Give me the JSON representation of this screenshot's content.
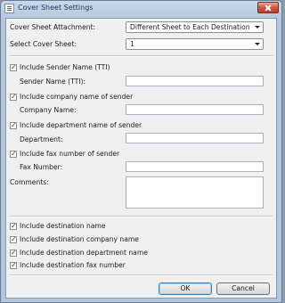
{
  "window": {
    "title": "Cover Sheet Settings"
  },
  "attachment": {
    "label": "Cover Sheet Attachment:",
    "value": "Different Sheet to Each Destination"
  },
  "select_sheet": {
    "label": "Select Cover Sheet:",
    "value": "1"
  },
  "sender": [
    {
      "checkbox_label": "Include Sender Name (TTI)",
      "checked": true,
      "field_label": "Sender Name (TTI):",
      "value": ""
    },
    {
      "checkbox_label": "Include company name of sender",
      "checked": true,
      "field_label": "Company Name:",
      "value": ""
    },
    {
      "checkbox_label": "Include department name of sender",
      "checked": true,
      "field_label": "Department:",
      "value": ""
    },
    {
      "checkbox_label": "Include fax number of sender",
      "checked": true,
      "field_label": "Fax Number:",
      "value": ""
    }
  ],
  "comments": {
    "label": "Comments:",
    "value": ""
  },
  "destination": [
    {
      "label": "Include destination name",
      "checked": true
    },
    {
      "label": "Include destination company name",
      "checked": true
    },
    {
      "label": "Include destination department name",
      "checked": true
    },
    {
      "label": "Include destination fax number",
      "checked": true
    }
  ],
  "buttons": {
    "ok": "OK",
    "cancel": "Cancel"
  }
}
